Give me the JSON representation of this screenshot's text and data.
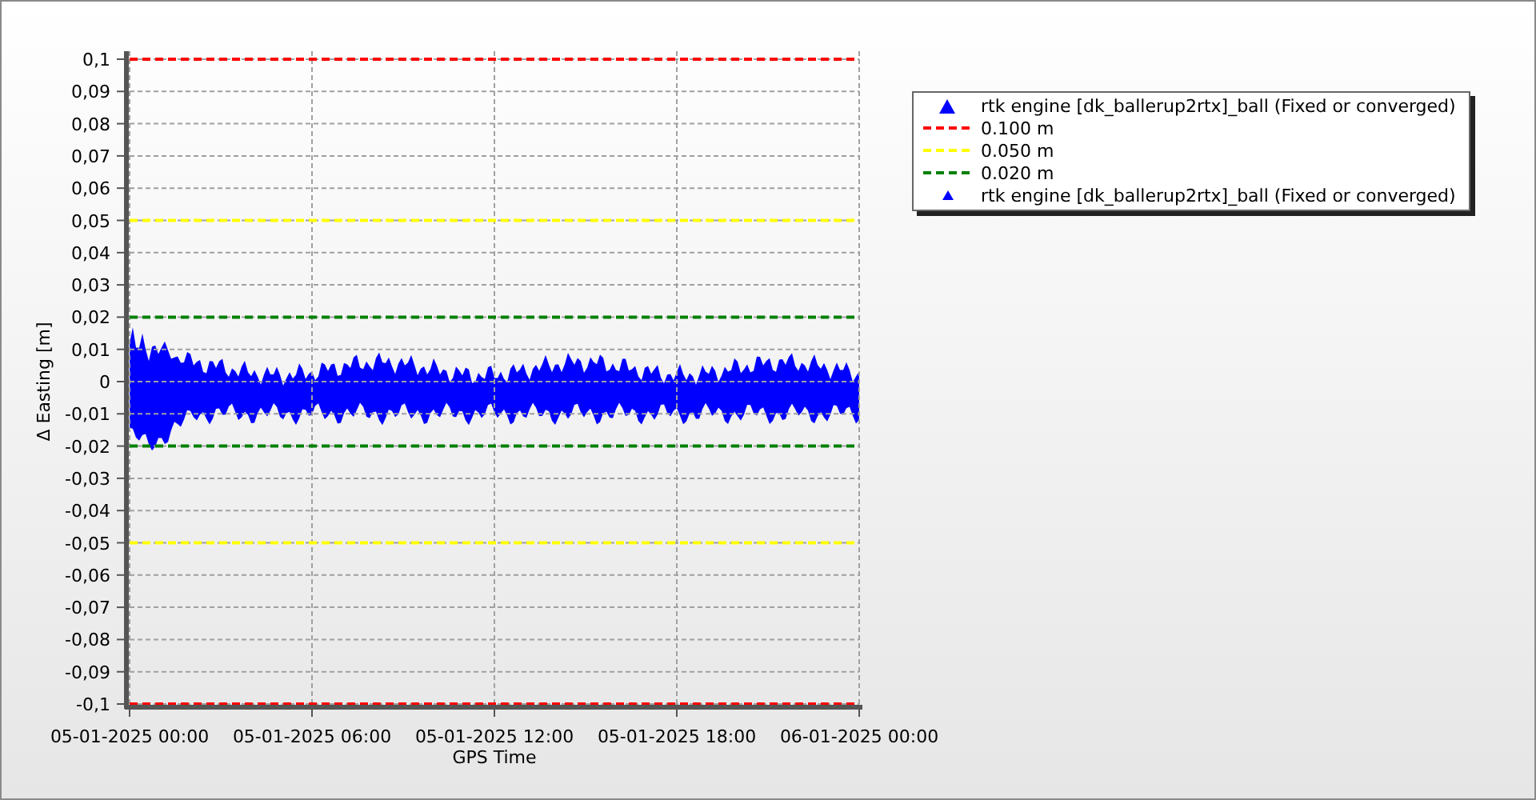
{
  "chart": {
    "chart_data": {
      "type": "line",
      "grid": true,
      "xlabel": "GPS Time",
      "ylabel": "Δ Easting [m]",
      "categories": [
        "05-01-2025 00:00",
        "05-01-2025 06:00",
        "05-01-2025 12:00",
        "05-01-2025 18:00",
        "06-01-2025 00:00"
      ],
      "ylim": [
        -0.1,
        0.1
      ],
      "yticks": [
        {
          "value": 0.1,
          "label": "0,1"
        },
        {
          "value": 0.09,
          "label": "0,09"
        },
        {
          "value": 0.08,
          "label": "0,08"
        },
        {
          "value": 0.07,
          "label": "0,07"
        },
        {
          "value": 0.06,
          "label": "0,06"
        },
        {
          "value": 0.05,
          "label": "0,05"
        },
        {
          "value": 0.04,
          "label": "0,04"
        },
        {
          "value": 0.03,
          "label": "0,03"
        },
        {
          "value": 0.02,
          "label": "0,02"
        },
        {
          "value": 0.01,
          "label": "0,01"
        },
        {
          "value": 0,
          "label": "0"
        },
        {
          "value": -0.01,
          "label": "-0,01"
        },
        {
          "value": -0.02,
          "label": "-0,02"
        },
        {
          "value": -0.03,
          "label": "-0,03"
        },
        {
          "value": -0.04,
          "label": "-0,04"
        },
        {
          "value": -0.05,
          "label": "-0,05"
        },
        {
          "value": -0.06,
          "label": "-0,06"
        },
        {
          "value": -0.07,
          "label": "-0,07"
        },
        {
          "value": -0.08,
          "label": "-0,08"
        },
        {
          "value": -0.09,
          "label": "-0,09"
        },
        {
          "value": -0.1,
          "label": "-0,1"
        }
      ],
      "series": [
        {
          "name": "0.100 m",
          "color": "#ff0000",
          "line_style": "dashed",
          "values": [
            0.1,
            0.1,
            0.1,
            0.1,
            0.1
          ]
        },
        {
          "color": "#ff0000",
          "line_style": "dashed",
          "values": [
            -0.1,
            -0.1,
            -0.1,
            -0.1,
            -0.1
          ]
        },
        {
          "name": "0.050 m",
          "color": "#ffff00",
          "line_style": "dashed",
          "values": [
            0.05,
            0.05,
            0.05,
            0.05,
            0.05
          ]
        },
        {
          "color": "#ffff00",
          "line_style": "dashed",
          "values": [
            -0.05,
            -0.05,
            -0.05,
            -0.05,
            -0.05
          ]
        },
        {
          "name": "0.020 m",
          "color": "#008000",
          "line_style": "dashed",
          "values": [
            0.02,
            0.02,
            0.02,
            0.02,
            0.02
          ]
        },
        {
          "color": "#008000",
          "line_style": "dashed",
          "values": [
            -0.02,
            -0.02,
            -0.02,
            -0.02,
            -0.02
          ]
        }
      ]
    },
    "legend": [
      {
        "label": "rtk engine [dk_ballerup2rtx]_ball (Fixed or converged)",
        "kind": "triangle",
        "color": "#0000ff"
      },
      {
        "kind": "series-lines"
      },
      {
        "label": "rtk engine [dk_ballerup2rtx]_ball (Fixed or converged)",
        "kind": "small-triangle",
        "color": "#0000ff"
      }
    ]
  }
}
